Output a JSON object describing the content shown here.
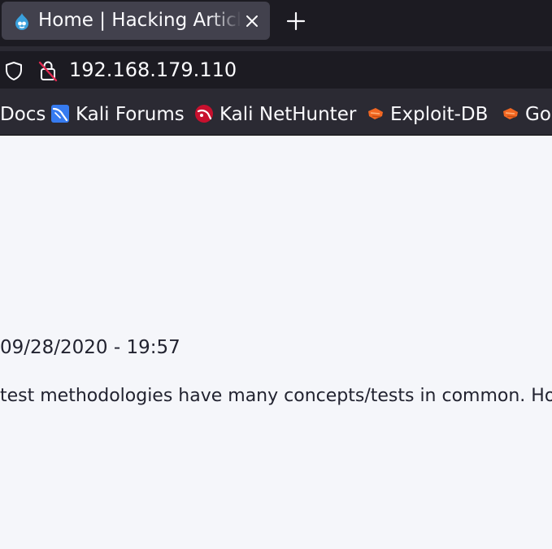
{
  "tab": {
    "title": "Home | Hacking Articles",
    "favicon": "drupal-icon",
    "close_icon": "close-icon",
    "new_tab_icon": "plus-icon"
  },
  "urlbar": {
    "url": "192.168.179.110",
    "shield_icon": "shield-icon",
    "lock_icon": "insecure-lock-icon"
  },
  "bookmarks": [
    {
      "label": "Docs",
      "icon": "none"
    },
    {
      "label": "Kali Forums",
      "icon": "kali-forums-icon"
    },
    {
      "label": "Kali NetHunter",
      "icon": "kali-nethunter-icon"
    },
    {
      "label": "Exploit-DB",
      "icon": "exploit-db-icon"
    },
    {
      "label": "Go",
      "icon": "exploit-db-icon"
    }
  ],
  "page": {
    "date": "09/28/2020 - 19:57",
    "excerpt": "test methodologies have many concepts/tests in common. Howe"
  },
  "colors": {
    "tabbar_bg": "#1c1b22",
    "tab_bg": "#42414d",
    "toolbar_bg": "#2b2a33",
    "page_bg": "#f5f6fa",
    "text_light": "#fbfbfe",
    "text_dark": "#222330",
    "insecure_red": "#e22850",
    "exploit_orange": "#f26722"
  }
}
